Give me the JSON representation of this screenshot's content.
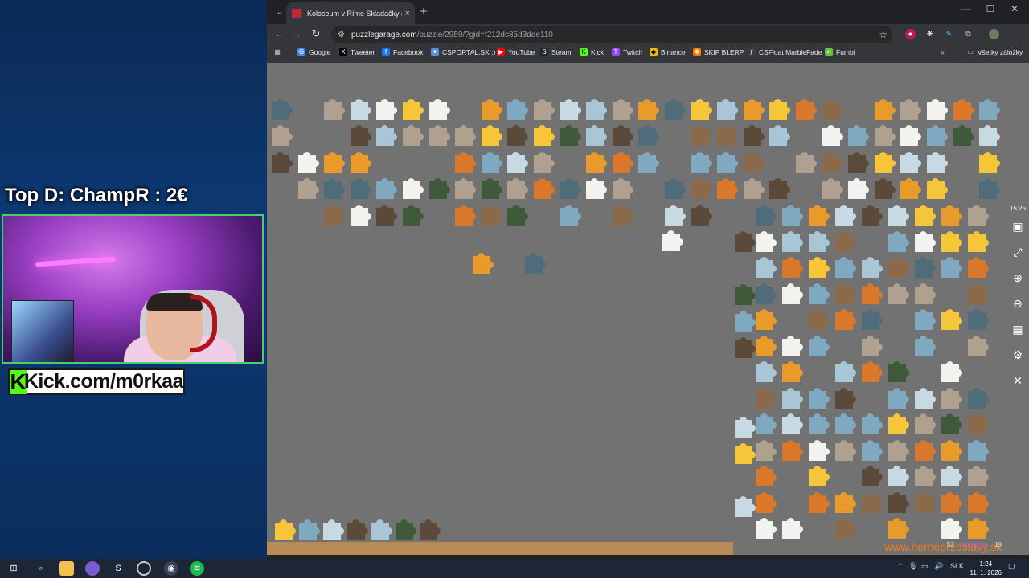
{
  "overlay": {
    "donation_text": "Top D: ChampR : 2€",
    "kick_banner": "Kick.com/m0rkaa",
    "kick_letter": "K"
  },
  "browser": {
    "tab_title": "Koloseum v Ríme Skladačky (Kol",
    "tab_close": "×",
    "new_tab": "+",
    "url_host": "puzzlegarage.com",
    "url_path": "/puzzle/2959/?gid=f212dc85d3dde110",
    "bookmarks": [
      {
        "label": "Google",
        "color": "#4285f4",
        "icon": "G"
      },
      {
        "label": "Tweeter",
        "color": "#000000",
        "icon": "X"
      },
      {
        "label": "Facebook",
        "color": "#1877f2",
        "icon": "f"
      },
      {
        "label": "CSPORTAL.SK :)",
        "color": "#5a8fd8",
        "icon": "✦"
      },
      {
        "label": "YouTube",
        "color": "#ff0000",
        "icon": "▶"
      },
      {
        "label": "Steam",
        "color": "#1b2838",
        "icon": "S"
      },
      {
        "label": "Kick",
        "color": "#53fc18",
        "icon": "K"
      },
      {
        "label": "Twitch",
        "color": "#9146ff",
        "icon": "T"
      },
      {
        "label": "Binance",
        "color": "#f0b90b",
        "icon": "◆"
      },
      {
        "label": "SKIP BLERP",
        "color": "#ff7a00",
        "icon": "✱"
      },
      {
        "label": "CSFloat MarbleFade",
        "color": "#3a3a3a",
        "icon": "ƒ"
      },
      {
        "label": "Fumbi",
        "color": "#65c23a",
        "icon": "✓"
      }
    ],
    "all_bookmarks": "Všetky záložky"
  },
  "puzzle": {
    "timer": "15:25",
    "watermark": "www.herneprzostavy.sk",
    "bottom_counter": "52",
    "bottom_counter_2": "19",
    "bottom_label": "No Name"
  },
  "taskbar": {
    "language": "SLK",
    "time": "1:24",
    "date": "11. 1. 2026"
  }
}
